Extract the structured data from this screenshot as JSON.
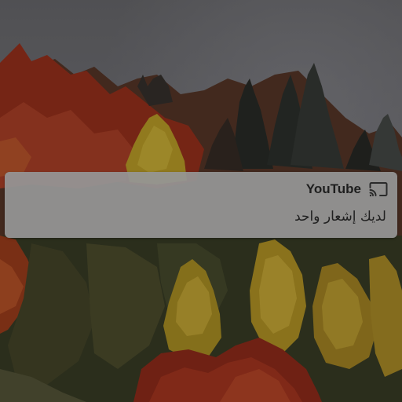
{
  "notification": {
    "app_name": "YouTube",
    "app_icon": "cast-icon",
    "message": "لديك إشعار واحد"
  },
  "colors": {
    "notification_bg": "#969696",
    "text": "#1e1e1e",
    "scrim": "#000000"
  }
}
